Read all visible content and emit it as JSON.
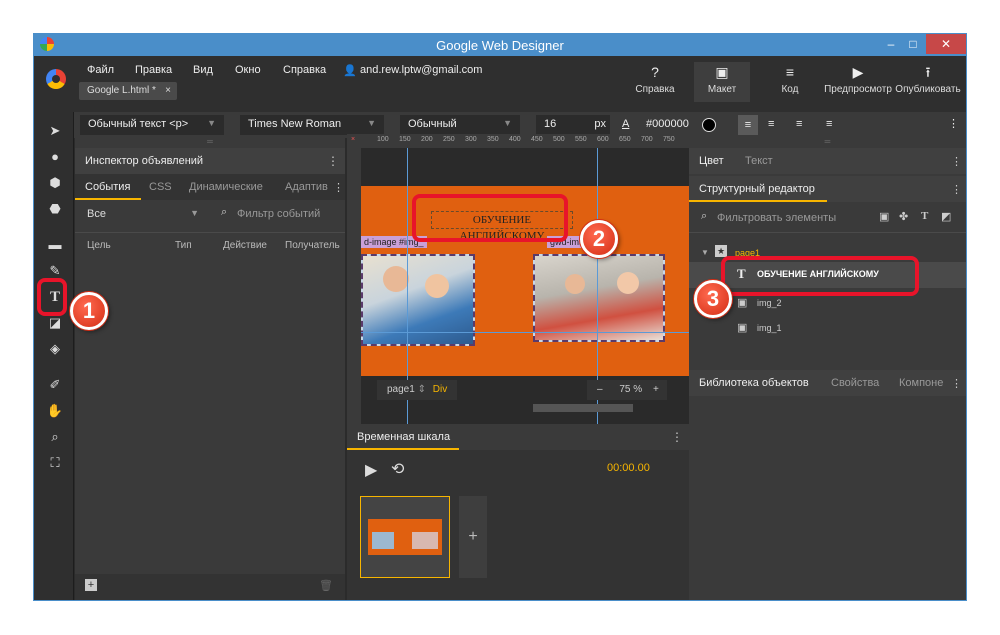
{
  "window": {
    "title": "Google Web Designer"
  },
  "menu": [
    "Файл",
    "Правка",
    "Вид",
    "Окно",
    "Справка"
  ],
  "user_email": "and.rew.lptw@gmail.com",
  "doc_tab": "Google L.html *",
  "doc_tab_close": "×",
  "toolbar": {
    "help": "Справка",
    "layout": "Макет",
    "code": "Код",
    "preview": "Предпросмотр",
    "publish": "Опубликовать"
  },
  "props": {
    "text_style": "Обычный текст <p>",
    "font": "Times New Roman",
    "weight": "Обычный",
    "size": "16",
    "unit": "px",
    "color": "#000000"
  },
  "inspector": {
    "title": "Инспектор объявлений",
    "tabs": [
      "События",
      "CSS",
      "Динамические",
      "Адаптив"
    ],
    "filter_all": "Все",
    "filter_placeholder": "Фильтр событий",
    "columns": [
      "Цель",
      "Тип",
      "Действие",
      "Получатель"
    ]
  },
  "canvas": {
    "heading": "ОБУЧЕНИЕ АНГЛИЙСКОМУ",
    "img_label_1": "d-image #img_",
    "img_label_2": "gwd-image",
    "page": "page1",
    "element": "Div",
    "zoom": "75",
    "zoom_unit": "%",
    "ruler_marks": [
      "100",
      "150",
      "200",
      "250",
      "300",
      "350",
      "400",
      "450",
      "500",
      "550",
      "600",
      "650",
      "700",
      "750"
    ]
  },
  "timeline": {
    "title": "Временная шкала",
    "time": "00:00.00",
    "add": "+"
  },
  "right": {
    "color_tabs": [
      "Цвет",
      "Текст"
    ],
    "struct_title": "Структурный редактор",
    "filter_placeholder": "Фильтровать элементы",
    "tree": [
      "page1",
      "ОБУЧЕНИЕ АНГЛИЙСКОМУ",
      "img_2",
      "img_1"
    ],
    "bottom_tabs": [
      "Библиотека объектов",
      "Свойства",
      "Компоне"
    ]
  },
  "callouts": [
    "1",
    "2",
    "3"
  ],
  "colors": {
    "accent": "#f7b500",
    "highlight": "#e8142a",
    "titlebar": "#4a8ec9",
    "stage": "#e06010"
  }
}
